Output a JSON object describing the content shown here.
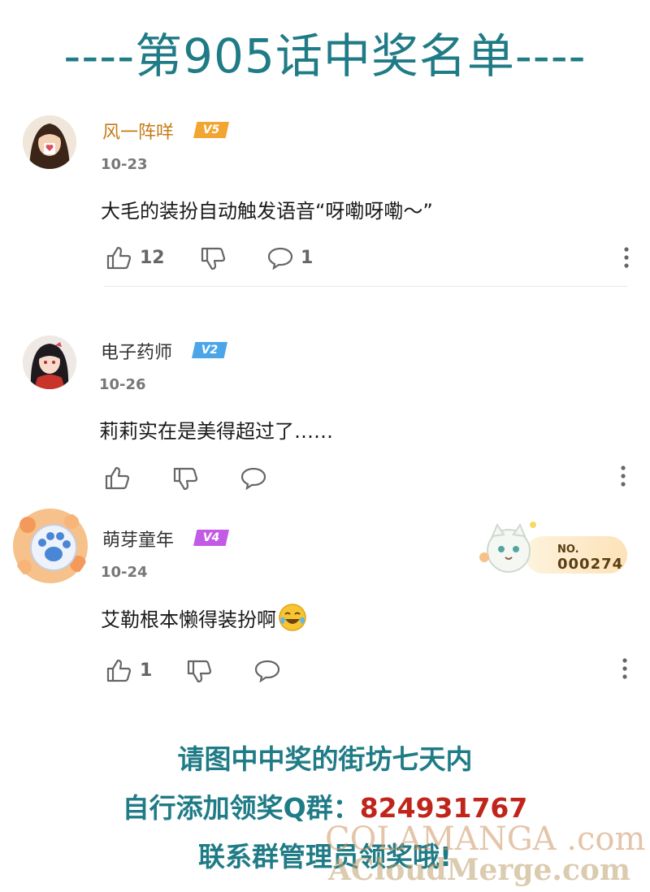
{
  "header": {
    "title": "----第905话中奖名单----"
  },
  "comments": [
    {
      "username": "风一阵咩",
      "level": "V5",
      "level_color": "#f2a530",
      "date": "10-23",
      "content": "大毛的装扮自动触发语音“呀嘞呀嘞～”",
      "likes": "12",
      "replies": "1"
    },
    {
      "username": "电子药师",
      "level": "V2",
      "level_color": "#4aa6e8",
      "date": "10-26",
      "content": "莉莉实在是美得超过了……"
    },
    {
      "username": "萌芽童年",
      "level": "V4",
      "level_color": "#c25ae6",
      "date": "10-24",
      "content": "艾勒根本懒得装扮啊",
      "emoji": "laughing-crying",
      "likes": "1",
      "medal": {
        "label": "NO.",
        "number": "000274"
      }
    }
  ],
  "icons": {
    "like": "thumbs-up-icon",
    "dislike": "thumbs-down-icon",
    "reply": "speech-bubble-icon",
    "more": "vertical-ellipsis-icon"
  },
  "footer": {
    "line1": "请图中中奖的街坊七天内",
    "line2_prefix": "自行添加领奖Q群：",
    "group_number": "824931767",
    "line3": "联系群管理员领奖哦!"
  },
  "watermark": {
    "line1": "COLAMANGA .com",
    "line2": "ACloudMerge.com"
  },
  "colors": {
    "accent": "#1f7b86",
    "highlight": "#c0251c",
    "gold_name": "#c67a16"
  }
}
